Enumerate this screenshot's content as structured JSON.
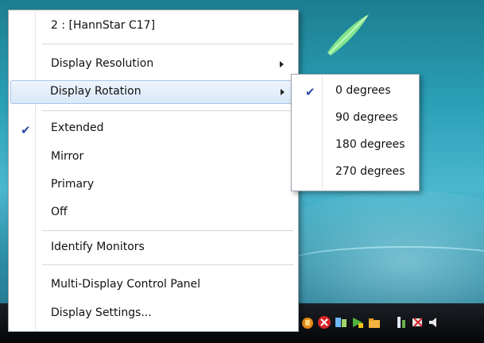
{
  "menu": {
    "monitor_header": "2 : [HannStar C17]",
    "display_resolution": "Display Resolution",
    "display_rotation": "Display Rotation",
    "modes": [
      {
        "label": "Extended",
        "checked": true
      },
      {
        "label": "Mirror",
        "checked": false
      },
      {
        "label": "Primary",
        "checked": false
      },
      {
        "label": "Off",
        "checked": false
      }
    ],
    "identify_monitors": "Identify Monitors",
    "control_panel": "Multi-Display Control Panel",
    "display_settings": "Display Settings...",
    "check_glyph": "✔"
  },
  "rotation_submenu": {
    "options": [
      {
        "label": "0 degrees",
        "checked": true
      },
      {
        "label": "90 degrees",
        "checked": false
      },
      {
        "label": "180 degrees",
        "checked": false
      },
      {
        "label": "270 degrees",
        "checked": false
      }
    ]
  },
  "tray_icons": [
    "network-icon",
    "security-alert-icon",
    "sync-icon",
    "update-icon",
    "folder-icon",
    "connection-icon",
    "battery-icon",
    "volume-icon"
  ],
  "colors": {
    "highlight": "#d9e8f8",
    "check": "#2b49a8",
    "taskbar": "#050608"
  }
}
